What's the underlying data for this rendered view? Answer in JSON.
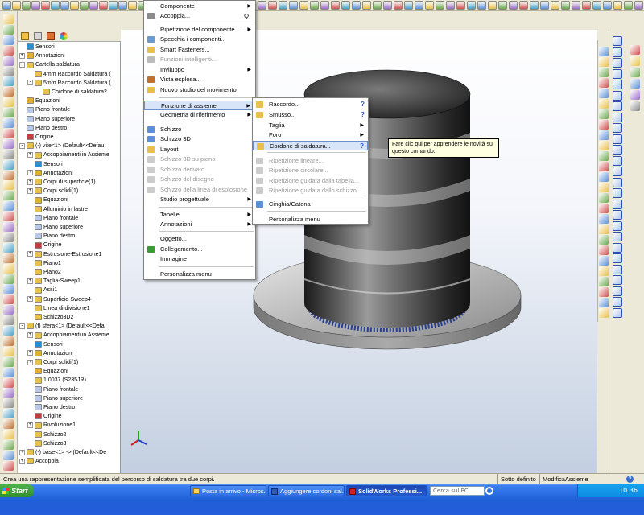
{
  "main_menu": {
    "items": [
      {
        "label": "Componente",
        "arrow": true
      },
      {
        "label": "Accoppia...",
        "shortcut": "Q"
      },
      {
        "label": "Ripetizione del componente...",
        "arrow": true
      },
      {
        "label": "Specchia i componenti..."
      },
      {
        "label": "Smart Fasteners..."
      },
      {
        "label": "Funzioni intelligenti...",
        "disabled": true
      },
      {
        "label": "Inviluppo",
        "arrow": true
      },
      {
        "label": "Vista esplosa..."
      },
      {
        "label": "Nuovo studio del movimento"
      },
      {
        "label": "Funzione di assieme",
        "arrow": true,
        "highlighted": true
      },
      {
        "label": "Geometria di riferimento",
        "arrow": true
      },
      {
        "label": "Schizzo"
      },
      {
        "label": "Schizzo 3D"
      },
      {
        "label": "Layout"
      },
      {
        "label": "Schizzo 3D su piano",
        "disabled": true
      },
      {
        "label": "Schizzo derivato",
        "disabled": true
      },
      {
        "label": "Schizzo del disegno",
        "disabled": true
      },
      {
        "label": "Schizzo della linea di esplosione",
        "disabled": true
      },
      {
        "label": "Studio progettuale",
        "arrow": true
      },
      {
        "label": "Tabelle",
        "arrow": true
      },
      {
        "label": "Annotazioni",
        "arrow": true
      },
      {
        "label": "Oggetto..."
      },
      {
        "label": "Collegamento..."
      },
      {
        "label": "Immagine"
      },
      {
        "label": "Personalizza menu"
      }
    ]
  },
  "sub_menu": {
    "items": [
      {
        "label": "Raccordo...",
        "help": "?"
      },
      {
        "label": "Smusso...",
        "help": "?"
      },
      {
        "label": "Taglia",
        "arrow": true
      },
      {
        "label": "Foro",
        "arrow": true
      },
      {
        "label": "Cordone di saldatura...",
        "help": "?",
        "highlighted": true
      },
      {
        "label": "Ripetizione lineare...",
        "disabled": true
      },
      {
        "label": "Ripetizione circolare...",
        "disabled": true
      },
      {
        "label": "Ripetizione guidata dalla tabella...",
        "disabled": true
      },
      {
        "label": "Ripetizione guidata dallo schizzo...",
        "disabled": true
      },
      {
        "label": "Cinghia/Catena"
      },
      {
        "label": "Personalizza menu"
      }
    ]
  },
  "tooltip": {
    "text": "Fare clic qui per apprendere le novità su questo comando."
  },
  "feature_tree": {
    "rows": [
      {
        "label": "Sensori",
        "indent": 1
      },
      {
        "label": "Annotazioni",
        "indent": 1,
        "expander": "+"
      },
      {
        "label": "Cartella saldatura",
        "indent": 1,
        "expander": "-"
      },
      {
        "label": "4mm Raccordo Saldatura (",
        "indent": 2
      },
      {
        "label": "5mm Raccordo Saldatura (",
        "indent": 2,
        "expander": "-"
      },
      {
        "label": "Cordone di saldatura2",
        "indent": 3
      },
      {
        "label": "Equazioni",
        "indent": 1
      },
      {
        "label": "Piano frontale",
        "indent": 1
      },
      {
        "label": "Piano superiore",
        "indent": 1
      },
      {
        "label": "Piano destro",
        "indent": 1
      },
      {
        "label": "Origine",
        "indent": 1
      },
      {
        "label": "(-) vite<1> (Default<<Defau",
        "indent": 1,
        "expander": "-"
      },
      {
        "label": "Accoppiamenti in Assieme",
        "indent": 2,
        "expander": "+"
      },
      {
        "label": "Sensori",
        "indent": 2
      },
      {
        "label": "Annotazioni",
        "indent": 2,
        "expander": "+"
      },
      {
        "label": "Corpi di superficie(1)",
        "indent": 2,
        "expander": "+"
      },
      {
        "label": "Corpi solidi(1)",
        "indent": 2,
        "expander": "+"
      },
      {
        "label": "Equazioni",
        "indent": 2
      },
      {
        "label": "Alluminio in lastre",
        "indent": 2
      },
      {
        "label": "Piano frontale",
        "indent": 2
      },
      {
        "label": "Piano superiore",
        "indent": 2
      },
      {
        "label": "Piano destro",
        "indent": 2
      },
      {
        "label": "Origine",
        "indent": 2
      },
      {
        "label": "Estrusione-Estrusione1",
        "indent": 2,
        "expander": "+"
      },
      {
        "label": "Piano1",
        "indent": 2
      },
      {
        "label": "Piano2",
        "indent": 2
      },
      {
        "label": "Taglia-Sweep1",
        "indent": 2,
        "expander": "+"
      },
      {
        "label": "Assi1",
        "indent": 2
      },
      {
        "label": "Superficie-Sweep4",
        "indent": 2,
        "expander": "+"
      },
      {
        "label": "Linea di divisione1",
        "indent": 2
      },
      {
        "label": "Schizzo3D2",
        "indent": 2
      },
      {
        "label": "(f) sfera<1> (Default<<Defa",
        "indent": 1,
        "expander": "-"
      },
      {
        "label": "Accoppiamenti in Assieme",
        "indent": 2,
        "expander": "+"
      },
      {
        "label": "Sensori",
        "indent": 2
      },
      {
        "label": "Annotazioni",
        "indent": 2,
        "expander": "+"
      },
      {
        "label": "Corpi solidi(1)",
        "indent": 2,
        "expander": "+"
      },
      {
        "label": "Equazioni",
        "indent": 2
      },
      {
        "label": "1.0037 (S235JR)",
        "indent": 2
      },
      {
        "label": "Piano frontale",
        "indent": 2
      },
      {
        "label": "Piano superiore",
        "indent": 2
      },
      {
        "label": "Piano destro",
        "indent": 2
      },
      {
        "label": "Origine",
        "indent": 2
      },
      {
        "label": "Rivoluzione1",
        "indent": 2,
        "expander": "+"
      },
      {
        "label": "Schizzo2",
        "indent": 2
      },
      {
        "label": "Schizzo3",
        "indent": 2
      },
      {
        "label": "(-) base<1> -> (Default<<De",
        "indent": 1,
        "expander": "+"
      },
      {
        "label": "Accoppia",
        "indent": 1,
        "expander": "+"
      }
    ]
  },
  "status_bar": {
    "message": "Crea una rappresentazione semplificata del percorso di saldatura tra due corpi.",
    "state": "Sotto definito",
    "mode": "ModificaAssieme"
  },
  "taskbar": {
    "start_label": "Start",
    "tasks": [
      {
        "label": "Posta in arrivo - Micros..."
      },
      {
        "label": "Aggiungere cordoni sal..."
      },
      {
        "label": "SolidWorks Professi...",
        "active": true
      }
    ],
    "search_placeholder": "Cerca sul PC",
    "clock": "10.36"
  },
  "colors": {
    "menu_highlight": "#d8e4f8",
    "menu_highlight_border": "#6c8fcb",
    "taskbar_blue": "#245edb",
    "start_green": "#3a9b35",
    "tooltip_bg": "#ffffe1",
    "viewport_top": "#ffffff",
    "viewport_bottom": "#c3cfe0"
  }
}
